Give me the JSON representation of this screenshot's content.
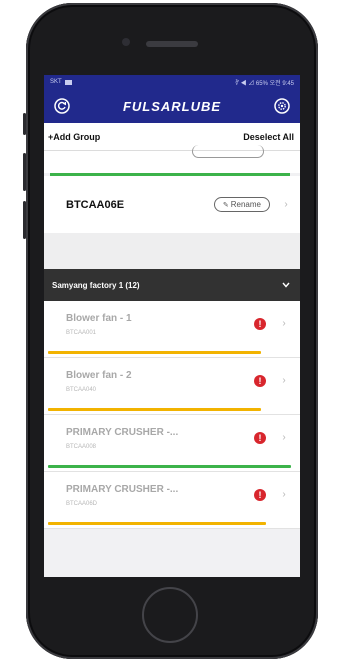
{
  "status_bar": {
    "left_text": "SKT",
    "right_text": "∛ ◀ ⊿ 65% 오전 9:45"
  },
  "app_bar": {
    "logo_text": "FULSARLUBE",
    "left_icon": "refresh-icon",
    "right_icon": "settings-icon"
  },
  "group_bar": {
    "add_label": "+Add Group",
    "deselect_label": "Deselect All"
  },
  "device": {
    "id": "BTCAA06E",
    "rename_label": "Rename"
  },
  "section": {
    "title": "Samyang factory 1 (12)"
  },
  "machines": [
    {
      "name": "Blower fan - 1",
      "code": "BTCAA001",
      "bar_color": "#f2b300",
      "bar_fraction": 0.86
    },
    {
      "name": "Blower fan - 2",
      "code": "BTCAA040",
      "bar_color": "#f2b300",
      "bar_fraction": 0.86
    },
    {
      "name": "PRIMARY CRUSHER -...",
      "code": "BTCAA008",
      "bar_color": "#3cb34a",
      "bar_fraction": 0.98
    },
    {
      "name": "PRIMARY CRUSHER -...",
      "code": "BTCAA06D",
      "bar_color": "#f2b300",
      "bar_fraction": 0.88
    }
  ],
  "colors": {
    "app_bar": "#21298c",
    "section_header": "#323232",
    "alert": "#d8262d"
  }
}
